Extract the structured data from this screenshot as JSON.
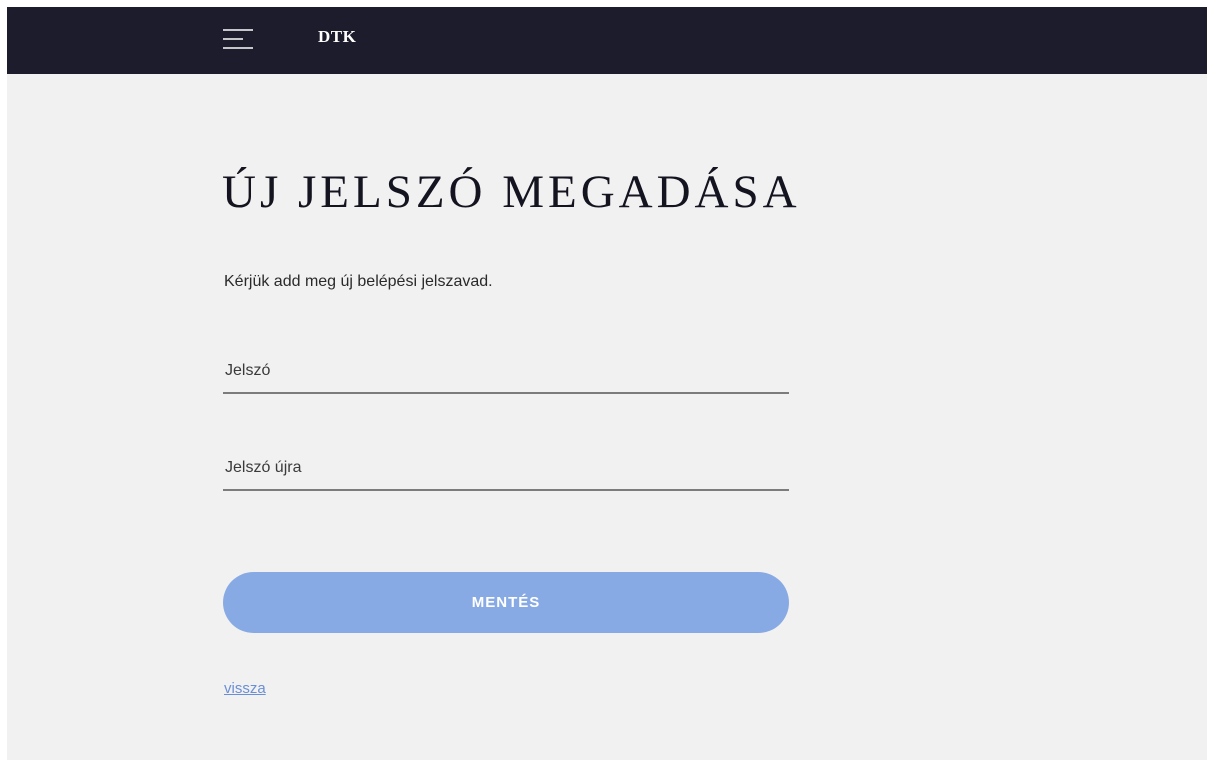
{
  "header": {
    "brand": "DTK",
    "menu_icon": "hamburger-menu-icon",
    "background_color": "#1c1c2c"
  },
  "main": {
    "title": "ÚJ JELSZÓ MEGADÁSA",
    "instructions": "Kérjük add meg új belépési jelszavad.",
    "password_field": {
      "placeholder": "Jelszó",
      "value": ""
    },
    "password_again_field": {
      "placeholder": "Jelszó újra",
      "value": ""
    },
    "save_button_label": "MENTÉS",
    "back_link_label": "vissza"
  },
  "colors": {
    "accent": "#88aae4",
    "link": "#6a8fd6",
    "background": "#f1f1f1"
  }
}
